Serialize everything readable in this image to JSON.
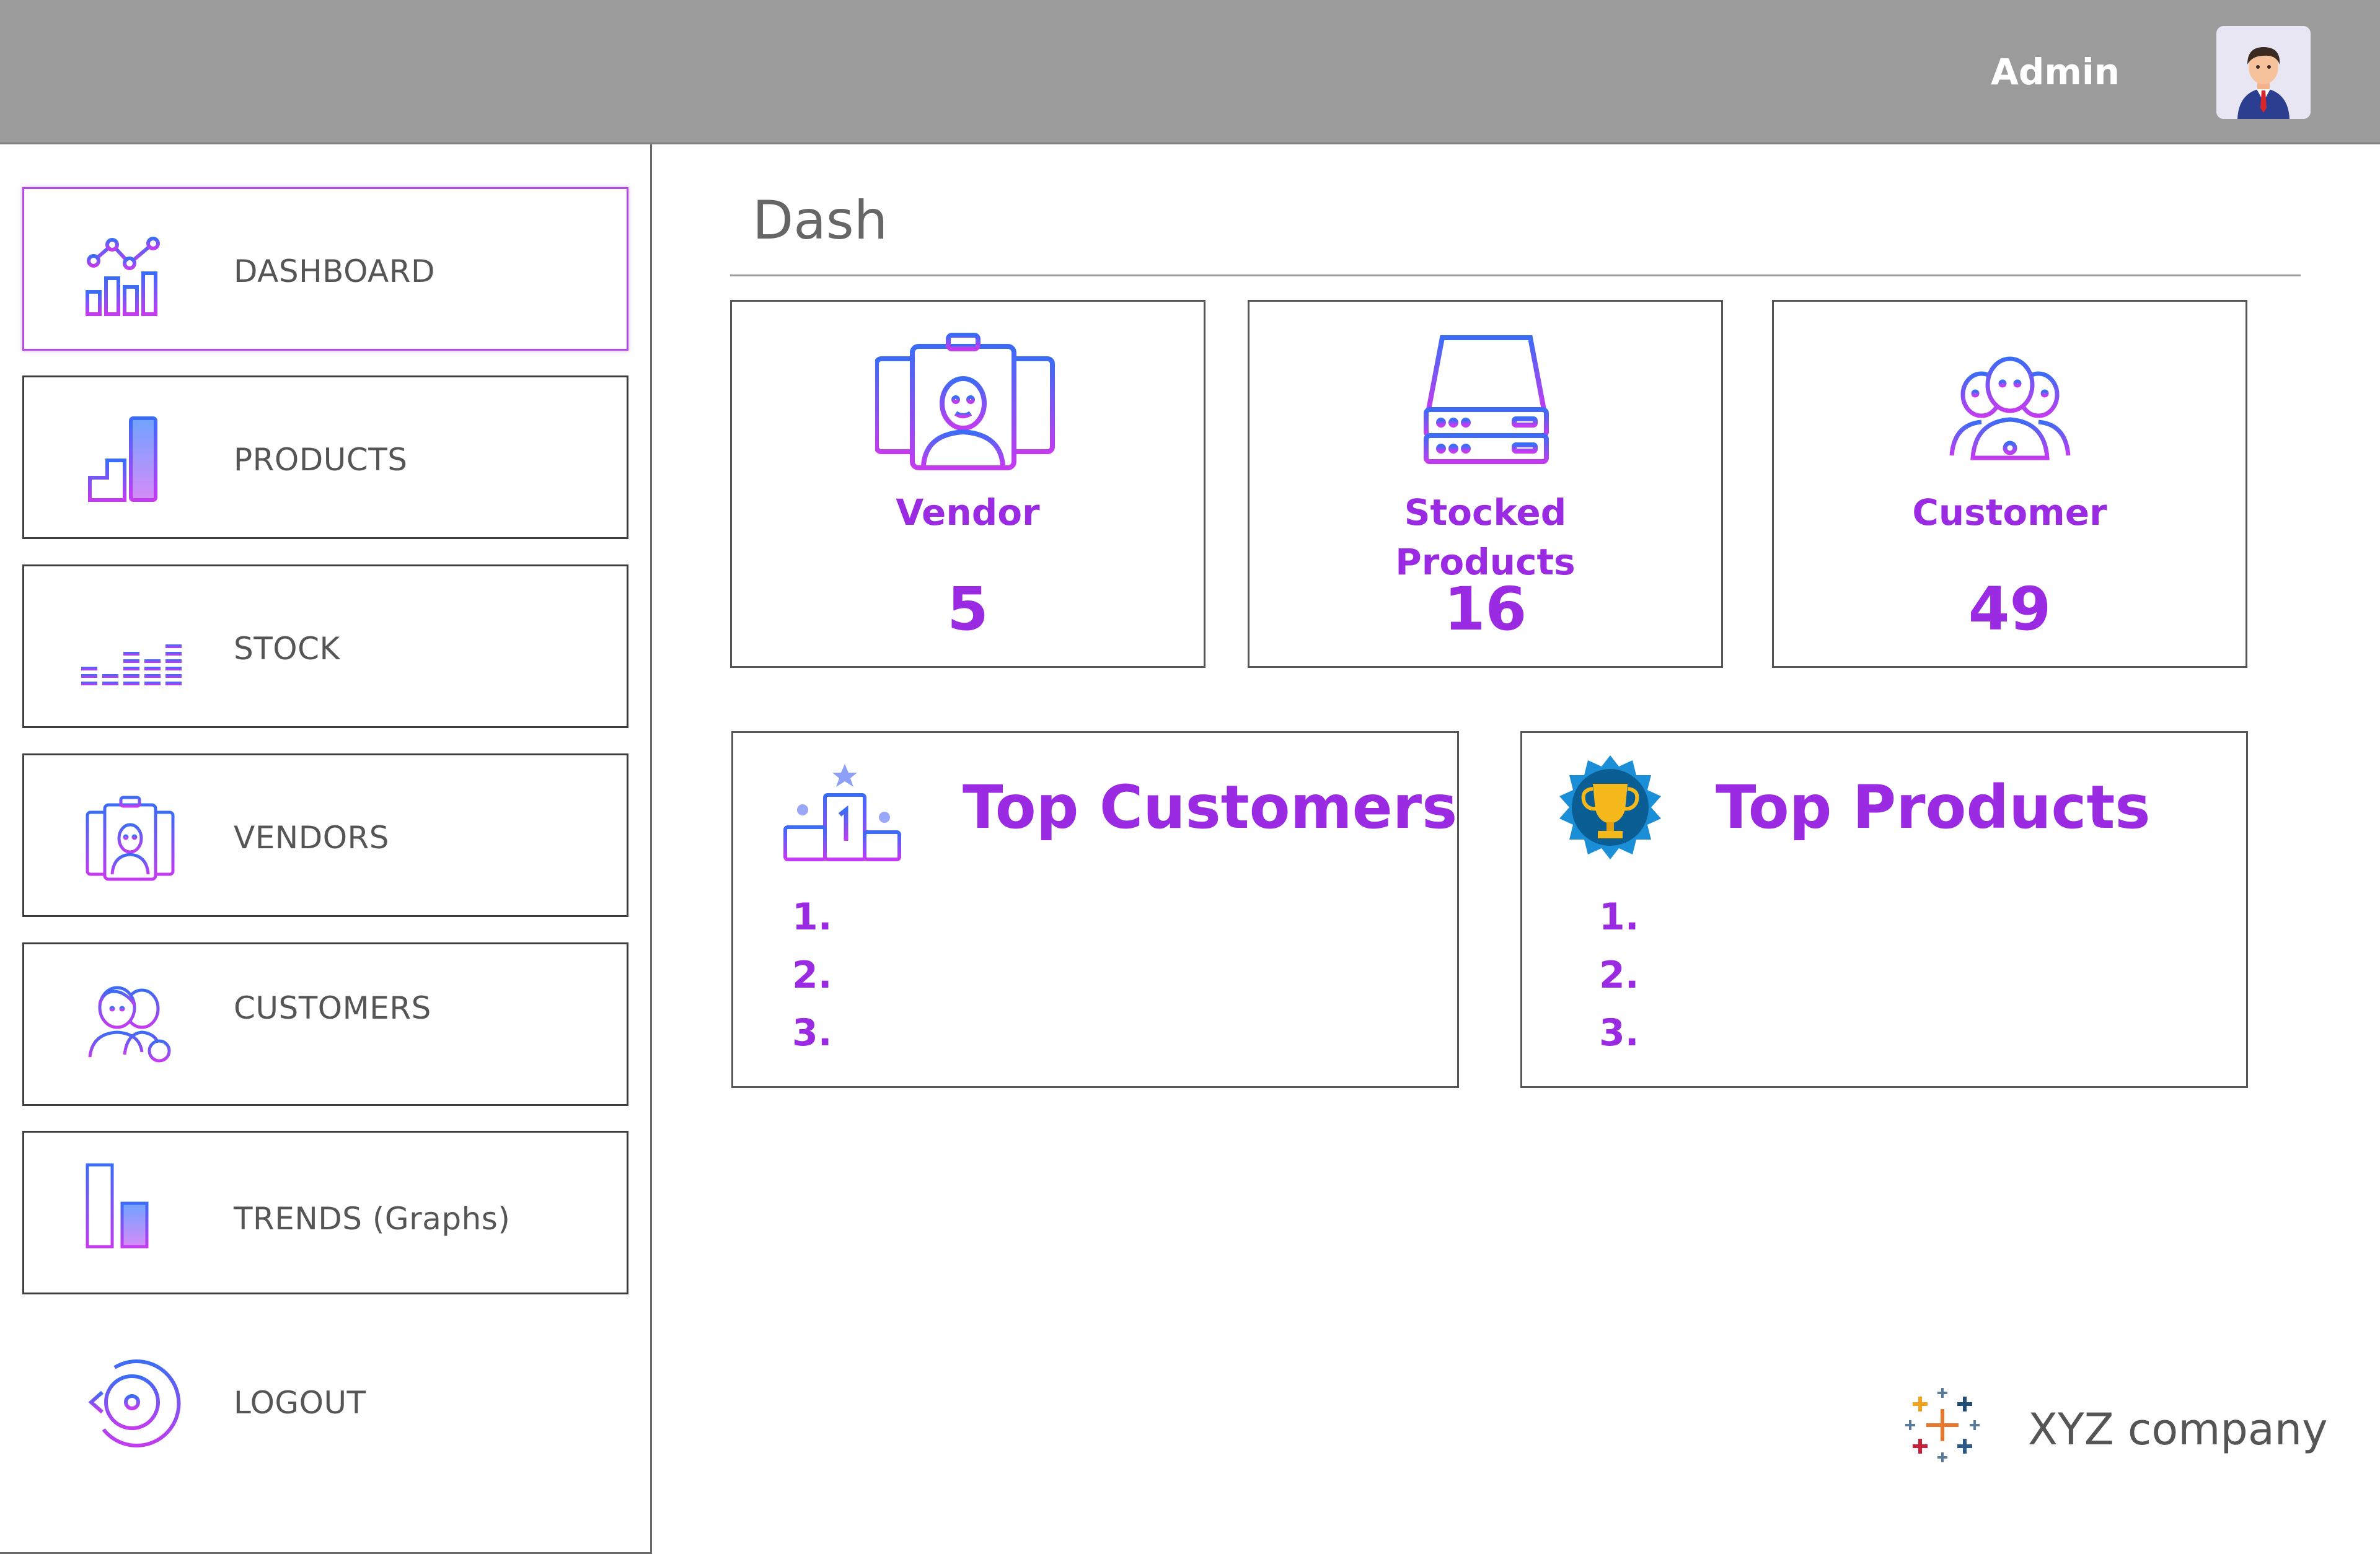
{
  "header": {
    "user_label": "Admin"
  },
  "sidebar": {
    "items": [
      {
        "label": "DASHBOARD",
        "icon": "dashboard-chart-icon",
        "active": true
      },
      {
        "label": "PRODUCTS",
        "icon": "products-steps-icon",
        "active": false
      },
      {
        "label": "STOCK",
        "icon": "stock-bars-icon",
        "active": false
      },
      {
        "label": "VENDORS",
        "icon": "vendor-badges-icon",
        "active": false
      },
      {
        "label": "CUSTOMERS",
        "icon": "customers-add-icon",
        "active": false
      },
      {
        "label": "TRENDS (Graphs)",
        "icon": "trends-bars-icon",
        "active": false
      },
      {
        "label": "LOGOUT",
        "icon": "logout-icon",
        "active": false
      }
    ]
  },
  "main": {
    "title": "Dash",
    "stats": [
      {
        "label": "Vendor",
        "value": "5",
        "icon": "vendor-badges-icon"
      },
      {
        "label_line1": "Stocked",
        "label_line2": "Products",
        "value": "16",
        "icon": "server-storage-icon"
      },
      {
        "label": "Customer",
        "value": "49",
        "icon": "customer-group-icon"
      }
    ],
    "top_customers": {
      "title": "Top Customers",
      "ranks": [
        "1.",
        "2.",
        "3."
      ],
      "icon": "podium-icon"
    },
    "top_products": {
      "title": "Top Products",
      "ranks": [
        "1.",
        "2.",
        "3."
      ],
      "icon": "trophy-badge-icon"
    }
  },
  "footer": {
    "company": "XYZ company",
    "logo": "tableau-cross-logo"
  },
  "colors": {
    "accent": "#9a2be2",
    "gradient_start": "#3b6cf6",
    "gradient_end": "#c43bf0",
    "topbar": "#9b9b9b"
  }
}
